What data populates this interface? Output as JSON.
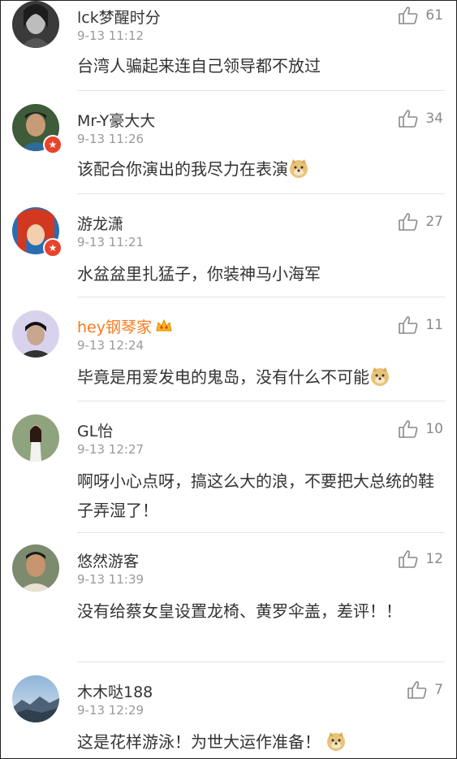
{
  "comments": [
    {
      "name": "lck梦醒时分",
      "time": "9-13 11:12",
      "likes": "61",
      "text": "台湾人骗起来连自己领导都不放过",
      "emoji": false,
      "badge": false,
      "vip": false
    },
    {
      "name": "Mr-Y豪大大",
      "time": "9-13 11:26",
      "likes": "34",
      "text": "该配合你演出的我尽力在表演",
      "emoji": true,
      "badge": true,
      "vip": false
    },
    {
      "name": "游龙潇",
      "time": "9-13 11:21",
      "likes": "27",
      "text": "水盆盆里扎猛子，你装神马小海军",
      "emoji": false,
      "badge": true,
      "vip": false
    },
    {
      "name": "hey钢琴家",
      "time": "9-13 12:24",
      "likes": "11",
      "text": "毕竟是用爱发电的鬼岛，没有什么不可能",
      "emoji": true,
      "badge": false,
      "vip": true
    },
    {
      "name": "GL怡",
      "time": "9-13 12:27",
      "likes": "10",
      "text": "啊呀小心点呀，搞这么大的浪，不要把大总统的鞋子弄湿了！",
      "emoji": false,
      "badge": false,
      "vip": false
    },
    {
      "name": "悠然游客",
      "time": "9-13 11:39",
      "likes": "12",
      "text": "没有给蔡女皇设置龙椅、黄罗伞盖，差评！！",
      "emoji": false,
      "badge": false,
      "vip": false
    },
    {
      "name": "木木哒188",
      "time": "9-13 12:29",
      "likes": "7",
      "text": "这是花样游泳！为世大运作准备！",
      "emoji": true,
      "badge": false,
      "vip": false
    }
  ],
  "colors": {
    "accent_name": "#f77b1f",
    "badge": "#e8432b",
    "meta": "#9a9a9a"
  },
  "icons": {
    "like": "thumbs-up-icon",
    "emoji": "doge-emoji-icon",
    "badge": "verified-badge-icon",
    "vip": "crown-icon"
  }
}
